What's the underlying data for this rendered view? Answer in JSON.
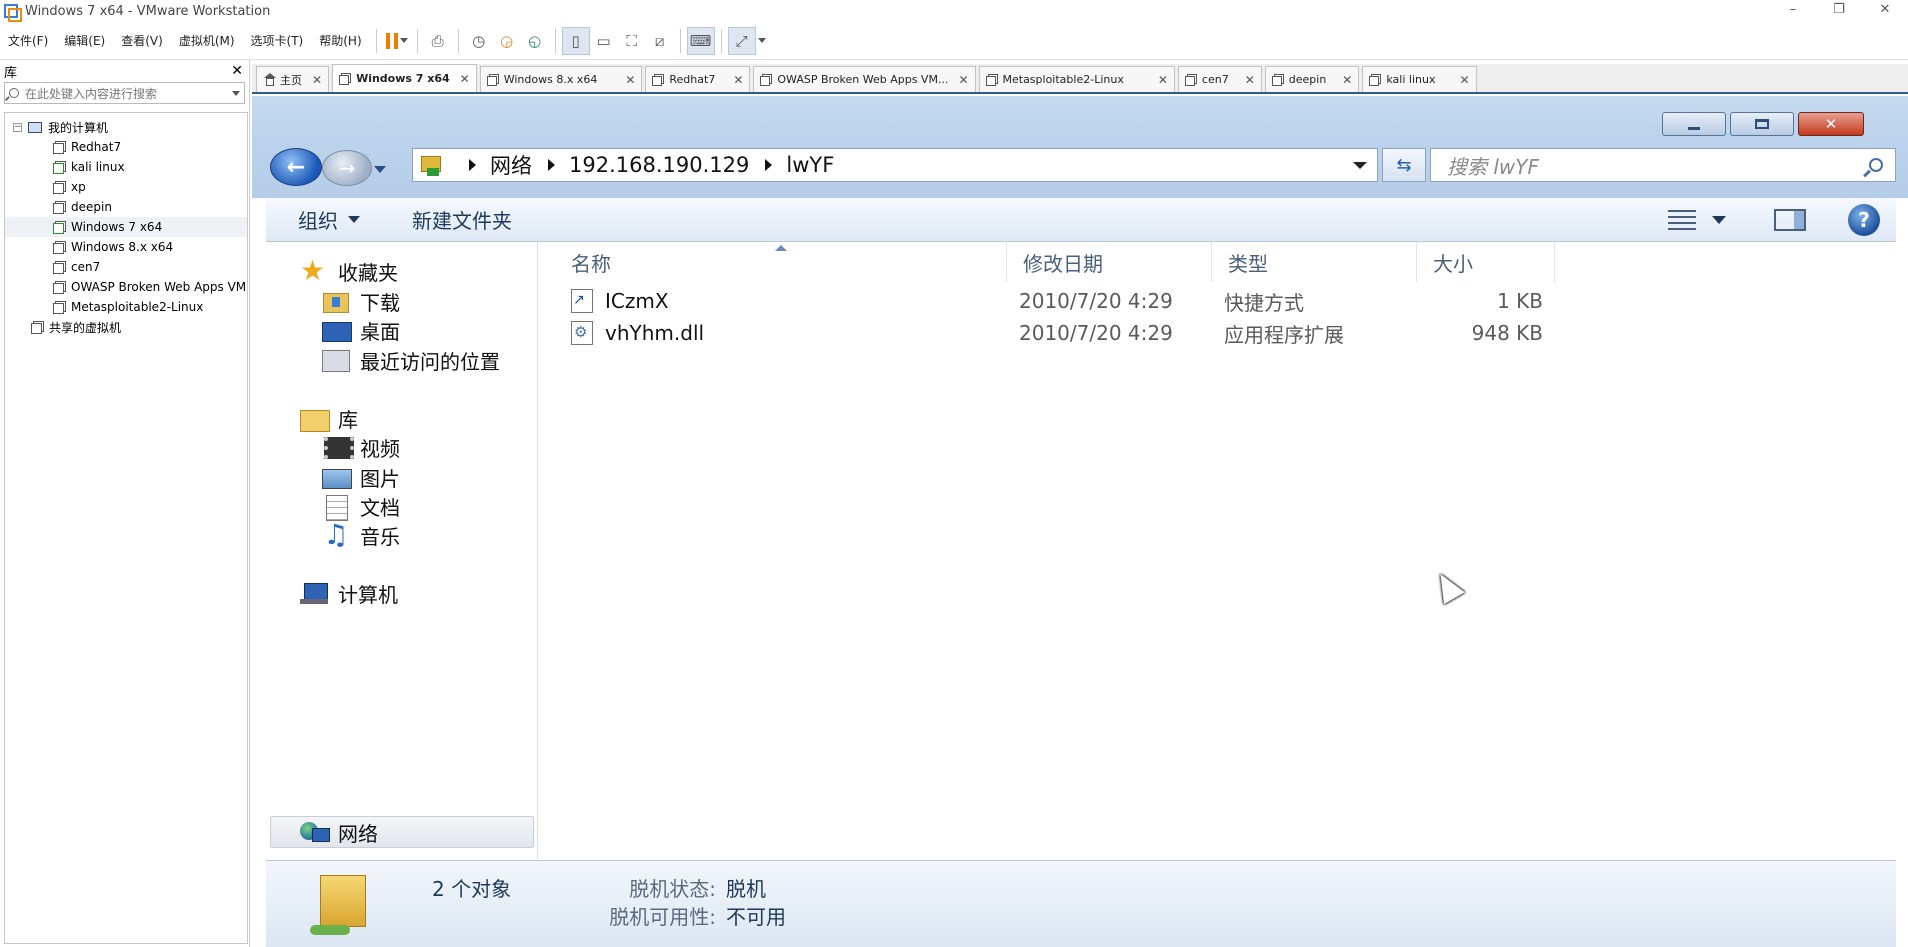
{
  "vmware": {
    "title": "Windows 7 x64 - VMware Workstation",
    "window_controls": {
      "minimize": "–",
      "restore": "❐",
      "close": "✕"
    },
    "menu": [
      "文件(F)",
      "编辑(E)",
      "查看(V)",
      "虚拟机(M)",
      "选项卡(T)",
      "帮助(H)"
    ],
    "library": {
      "title": "库",
      "close": "✕",
      "search_placeholder": "在此处键入内容进行搜索",
      "tree": {
        "root": "我的计算机",
        "vms": [
          "Redhat7",
          "kali linux",
          "xp",
          "deepin",
          "Windows 7 x64",
          "Windows 8.x x64",
          "cen7",
          "OWASP Broken Web Apps VM",
          "Metasploitable2-Linux"
        ],
        "shared": "共享的虚拟机"
      }
    },
    "tabs": [
      {
        "label": "主页",
        "close": "✕"
      },
      {
        "label": "Windows 7 x64",
        "close": "✕"
      },
      {
        "label": "Windows 8.x x64",
        "close": "✕"
      },
      {
        "label": "Redhat7",
        "close": "✕"
      },
      {
        "label": "OWASP Broken Web Apps VM...",
        "close": "✕"
      },
      {
        "label": "Metasploitable2-Linux",
        "close": "✕"
      },
      {
        "label": "cen7",
        "close": "✕"
      },
      {
        "label": "deepin",
        "close": "✕"
      },
      {
        "label": "kali linux",
        "close": "✕"
      }
    ]
  },
  "explorer": {
    "address": {
      "root": "网络",
      "host": "192.168.190.129",
      "folder": "lwYF"
    },
    "search_placeholder": "搜索 lwYF",
    "buttons": {
      "close": "✕",
      "back": "←",
      "forward": "→",
      "refresh": "⇆",
      "help": "?"
    },
    "commands": {
      "organize": "组织",
      "new_folder": "新建文件夹"
    },
    "nav": {
      "favorites": "收藏夹",
      "downloads": "下载",
      "desktop": "桌面",
      "recent": "最近访问的位置",
      "libraries": "库",
      "videos": "视频",
      "pictures": "图片",
      "documents": "文档",
      "music": "音乐",
      "computer": "计算机",
      "network": "网络"
    },
    "columns": {
      "name": "名称",
      "modified": "修改日期",
      "type": "类型",
      "size": "大小"
    },
    "files": [
      {
        "name": "ICzmX",
        "modified": "2010/7/20 4:29",
        "type": "快捷方式",
        "size": "1 KB",
        "icon": "shortcut-icon"
      },
      {
        "name": "vhYhm.dll",
        "modified": "2010/7/20 4:29",
        "type": "应用程序扩展",
        "size": "948 KB",
        "icon": "dll-icon"
      }
    ],
    "details": {
      "count": "2 个对象",
      "offline_status_label": "脱机状态:",
      "offline_status_value": "脱机",
      "offline_avail_label": "脱机可用性:",
      "offline_avail_value": "不可用"
    }
  }
}
